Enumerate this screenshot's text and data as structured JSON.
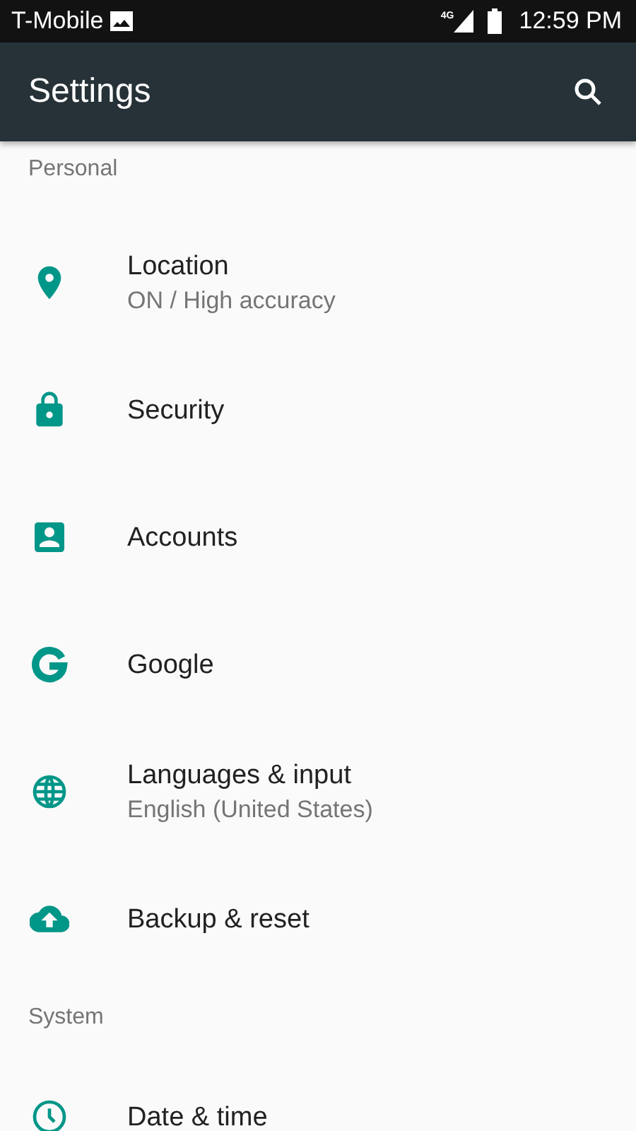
{
  "status_bar": {
    "carrier": "T-Mobile",
    "network": "4G",
    "time": "12:59 PM"
  },
  "toolbar": {
    "title": "Settings"
  },
  "sections": [
    {
      "title": "Personal",
      "items": [
        {
          "kind": "location",
          "title": "Location",
          "subtitle": "ON / High accuracy"
        },
        {
          "kind": "lock",
          "title": "Security"
        },
        {
          "kind": "account",
          "title": "Accounts"
        },
        {
          "kind": "google",
          "title": "Google"
        },
        {
          "kind": "globe",
          "title": "Languages & input",
          "subtitle": "English (United States)"
        },
        {
          "kind": "cloud",
          "title": "Backup & reset"
        }
      ]
    },
    {
      "title": "System",
      "items": [
        {
          "kind": "clock",
          "title": "Date & time"
        }
      ]
    }
  ]
}
